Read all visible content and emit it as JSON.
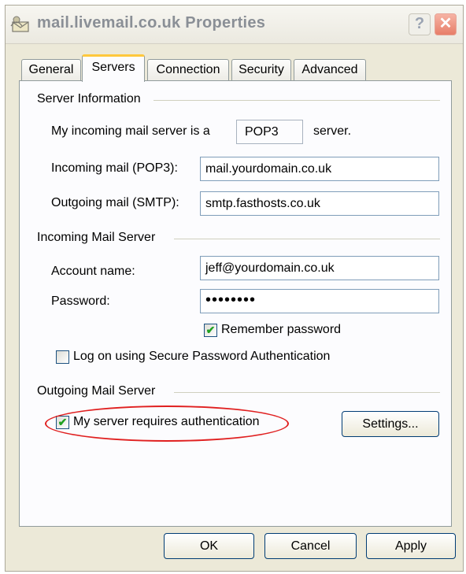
{
  "window": {
    "title": "mail.livemail.co.uk Properties",
    "help_label": "?",
    "close_label": "✕"
  },
  "tabs": [
    {
      "label": "General",
      "active": false
    },
    {
      "label": "Servers",
      "active": true
    },
    {
      "label": "Connection",
      "active": false
    },
    {
      "label": "Security",
      "active": false
    },
    {
      "label": "Advanced",
      "active": false
    }
  ],
  "server_info": {
    "heading": "Server Information",
    "incoming_type_prefix": "My incoming mail server is a",
    "incoming_type": "POP3",
    "incoming_type_suffix": "server.",
    "incoming_label": "Incoming mail (POP3):",
    "incoming_value": "mail.yourdomain.co.uk",
    "outgoing_label": "Outgoing mail (SMTP):",
    "outgoing_value": "smtp.fasthosts.co.uk"
  },
  "incoming_server": {
    "heading": "Incoming Mail Server",
    "account_label": "Account name:",
    "account_value": "jeff@yourdomain.co.uk",
    "password_label": "Password:",
    "password_mask": "••••••••",
    "remember_label": "Remember password",
    "remember_checked": true,
    "spa_label": "Log on using Secure Password Authentication",
    "spa_checked": false
  },
  "outgoing_server": {
    "heading": "Outgoing Mail Server",
    "auth_label": "My server requires authentication",
    "auth_checked": true,
    "settings_label": "Settings..."
  },
  "buttons": {
    "ok": "OK",
    "cancel": "Cancel",
    "apply": "Apply"
  },
  "colors": {
    "highlight_oval": "#e02020",
    "check_mark": "#21a121",
    "active_tab_accent": "#ffc83c"
  },
  "icons": {
    "title": "mail-account-icon",
    "check": "checkmark-icon"
  }
}
